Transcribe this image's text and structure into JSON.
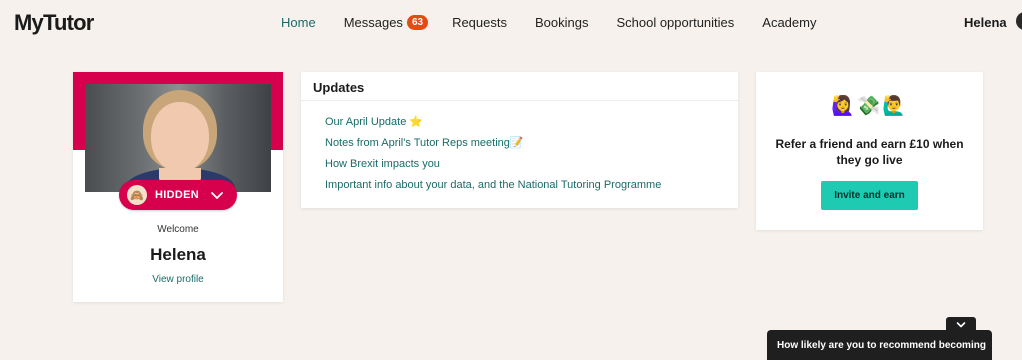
{
  "header": {
    "logo": "MyTutor",
    "nav": [
      {
        "label": "Home",
        "active": true
      },
      {
        "label": "Messages",
        "badge": "63"
      },
      {
        "label": "Requests"
      },
      {
        "label": "Bookings"
      },
      {
        "label": "School opportunities"
      },
      {
        "label": "Academy"
      }
    ],
    "user_name": "Helena"
  },
  "profile": {
    "status_label": "HIDDEN",
    "welcome": "Welcome",
    "name": "Helena",
    "view_profile": "View profile"
  },
  "updates": {
    "title": "Updates",
    "items": [
      "Our April Update ⭐",
      "Notes from April's Tutor Reps meeting📝",
      "How Brexit impacts you",
      "Important info about your data, and the National Tutoring Programme"
    ]
  },
  "refer": {
    "emojis": "🙋‍♀️💸🙋‍♂️",
    "text": "Refer a friend and earn £10 when they go live",
    "button": "Invite and earn"
  },
  "survey": {
    "text": "How likely are you to recommend becoming"
  },
  "colors": {
    "brand_pink": "#d6004d",
    "teal_link": "#1a6b68",
    "invite_button": "#1fcab3",
    "badge_orange": "#e44a12",
    "background": "#f6f1ec"
  }
}
